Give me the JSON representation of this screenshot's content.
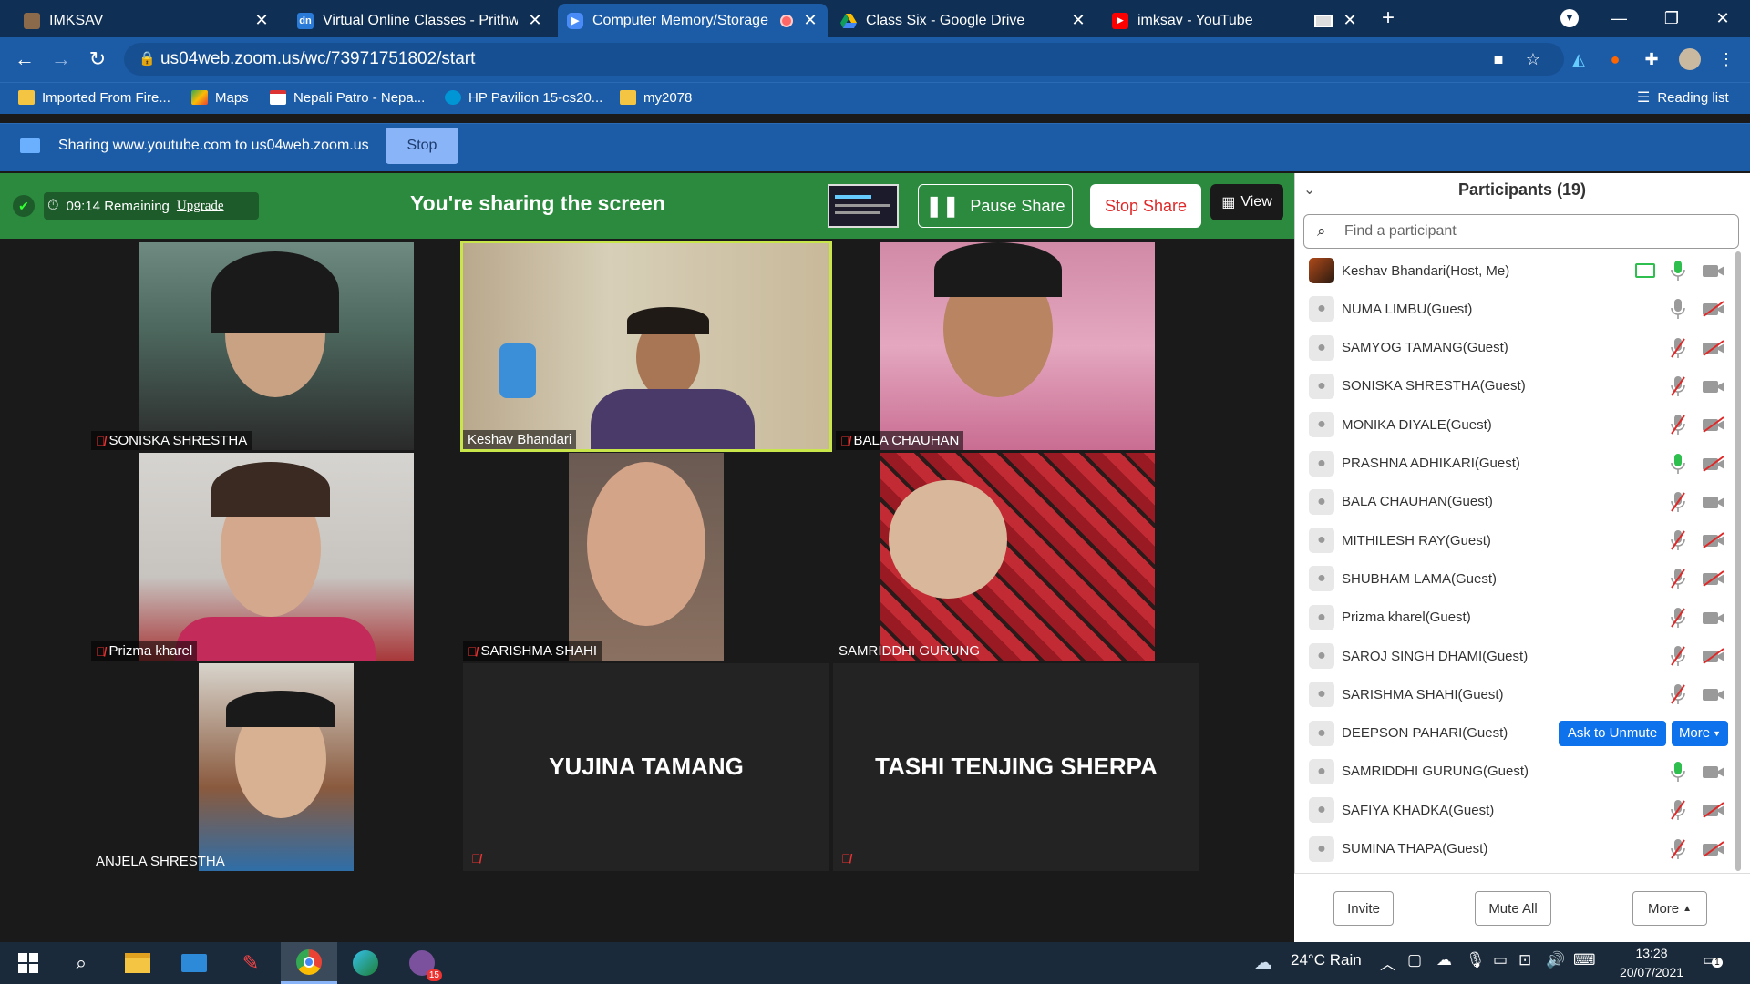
{
  "browser": {
    "tabs": [
      {
        "title": "IMKSAV",
        "icon": "user-icon",
        "active": false
      },
      {
        "title": "Virtual Online Classes - Prithwi S",
        "icon": "dn-icon",
        "active": false
      },
      {
        "title": "Computer Memory/Storage",
        "icon": "zoom-icon",
        "active": true
      },
      {
        "title": "Class Six - Google Drive",
        "icon": "drive-icon",
        "active": false
      },
      {
        "title": "imksav - YouTube",
        "icon": "youtube-icon",
        "active": false
      }
    ],
    "url": "us04web.zoom.us/wc/73971751802/start",
    "bookmarks": [
      "Imported From Fire...",
      "Maps",
      "Nepali Patro - Nepa...",
      "HP Pavilion 15-cs20...",
      "my2078"
    ],
    "reading_list": "Reading list"
  },
  "sharebar": {
    "text": "Sharing www.youtube.com to us04web.zoom.us",
    "stop": "Stop"
  },
  "zoom": {
    "timer": "09:14 Remaining",
    "upgrade": "Upgrade",
    "sharing_title": "You're sharing the screen",
    "pause_share": "Pause Share",
    "stop_share": "Stop Share",
    "view": "View"
  },
  "videos": [
    {
      "name": "SONISKA SHRESTHA",
      "muted": true
    },
    {
      "name": "Keshav Bhandari",
      "muted": false
    },
    {
      "name": "BALA CHAUHAN",
      "muted": true
    },
    {
      "name": "Prizma kharel",
      "muted": true
    },
    {
      "name": "SARISHMA SHAHI",
      "muted": true
    },
    {
      "name": "SAMRIDDHI GURUNG",
      "muted": false
    },
    {
      "name": "ANJELA SHRESTHA",
      "muted": false
    },
    {
      "name": "YUJINA TAMANG",
      "muted": true
    },
    {
      "name": "TASHI TENJING SHERPA",
      "muted": true
    }
  ],
  "participants": {
    "title": "Participants (19)",
    "search_placeholder": "Find a participant",
    "list": [
      {
        "name": "Keshav Bhandari(Host, Me)",
        "mic": "on",
        "cam": "on",
        "sharing": true
      },
      {
        "name": "NUMA LIMBU(Guest)",
        "mic": "idle",
        "cam": "off"
      },
      {
        "name": "SAMYOG TAMANG(Guest)",
        "mic": "off",
        "cam": "off"
      },
      {
        "name": "SONISKA SHRESTHA(Guest)",
        "mic": "off",
        "cam": "on"
      },
      {
        "name": "MONIKA DIYALE(Guest)",
        "mic": "off",
        "cam": "off"
      },
      {
        "name": "PRASHNA ADHIKARI(Guest)",
        "mic": "on",
        "cam": "off"
      },
      {
        "name": "BALA CHAUHAN(Guest)",
        "mic": "off",
        "cam": "on"
      },
      {
        "name": "MITHILESH RAY(Guest)",
        "mic": "off",
        "cam": "off"
      },
      {
        "name": "SHUBHAM LAMA(Guest)",
        "mic": "off",
        "cam": "off"
      },
      {
        "name": "Prizma kharel(Guest)",
        "mic": "off",
        "cam": "on"
      },
      {
        "name": "SAROJ SINGH DHAMI(Guest)",
        "mic": "off",
        "cam": "off"
      },
      {
        "name": "SARISHMA SHAHI(Guest)",
        "mic": "off",
        "cam": "on"
      },
      {
        "name": "DEEPSON PAHARI(Guest)",
        "mic": "none",
        "cam": "none"
      },
      {
        "name": "SAMRIDDHI GURUNG(Guest)",
        "mic": "on",
        "cam": "on"
      },
      {
        "name": "SAFIYA KHADKA(Guest)",
        "mic": "off",
        "cam": "off"
      },
      {
        "name": "SUMINA THAPA(Guest)",
        "mic": "off",
        "cam": "off"
      }
    ],
    "ask_to_unmute": "Ask to Unmute",
    "more_row": "More",
    "invite": "Invite",
    "mute_all": "Mute All",
    "more": "More"
  },
  "taskbar": {
    "weather": "24°C  Rain",
    "time": "13:28",
    "date": "20/07/2021",
    "badge": "15",
    "notif": "1"
  },
  "colors": {
    "chrome_dark": "#0f2f55",
    "chrome": "#1c5ba6",
    "zoom_green": "#2b8a3e",
    "zoom_blue": "#0e72ed"
  }
}
